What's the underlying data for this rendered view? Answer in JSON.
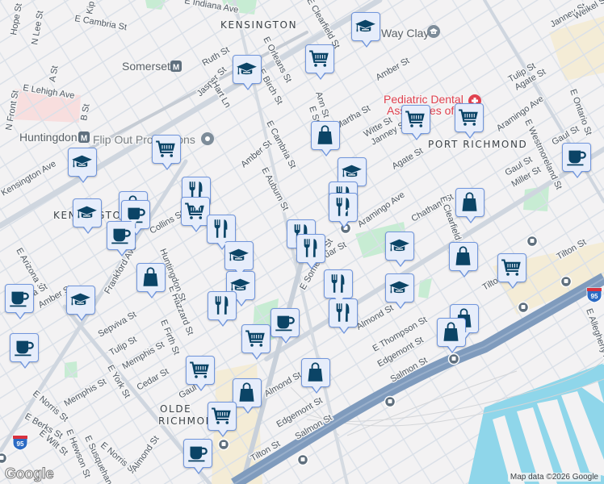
{
  "neighborhoods": [
    "KENSINGTON",
    "KENSINGTON",
    "PORT RICHMOND",
    "OLDE",
    "RICHMOND"
  ],
  "pois": {
    "somerset_station": "Somerset",
    "huntingdon_station": "Huntingdon",
    "flip_out": "Flip Out Productions",
    "way_clay": "Way Clay",
    "dental_line1": "Pediatric Dental",
    "dental_line2": "Associates of"
  },
  "streets": [
    "E Indiana Ave",
    "E Cambria St",
    "Hope St",
    "N Lee St",
    "Kip St",
    "Ruth St",
    "Jasper St",
    "Hart Ln",
    "E Orleans St",
    "E Birch St",
    "E Lehigh Ave",
    "A St",
    "N Front St",
    "B St",
    "Kensington Ave",
    "E Cambria St",
    "Amber St",
    "E Auburn St",
    "E Clearfield St",
    "Amber St",
    "Ann St",
    "E Sterner St",
    "Martha St",
    "Witte St",
    "Janney St",
    "Agate St",
    "Aramingo Ave",
    "Aramingo Ave",
    "Tulip St",
    "Agate St",
    "E Ontario St",
    "E Westmoreland St",
    "Gaul St",
    "Gaul St",
    "Miller St",
    "Janney St",
    "Weikel St",
    "Cedar St",
    "E Somerset St",
    "Chatham St",
    "E Clearfield St",
    "Tilton St",
    "Tilton St",
    "E Thompson St",
    "Edgemont St",
    "Salmon St",
    "Almond St",
    "E Allegheny Ave",
    "E Arizona St",
    "Amber St",
    "Sepviva St",
    "Tulip St",
    "Memphis St",
    "E Firth St",
    "E Hazzard St",
    "Huntingdon St",
    "E York St",
    "Cedar St",
    "Memphis St",
    "E Norris St",
    "E Berks St",
    "E Wilt St",
    "E Hewson St",
    "E Susquehanna",
    "E Norris St",
    "Almond St",
    "Almond St",
    "Edgemont St",
    "Salmon St",
    "Tilton St",
    "Gaul St",
    "Frankford Ave",
    "Martha St",
    "Collins St"
  ],
  "markers": [
    "school",
    "cart",
    "school",
    "cart",
    "school",
    "bag",
    "cart",
    "cart",
    "school",
    "food",
    "food",
    "food",
    "cart",
    "bag",
    "bag",
    "cup",
    "school",
    "cup",
    "food",
    "food",
    "food",
    "school",
    "school",
    "bag",
    "cart",
    "bag",
    "school",
    "school",
    "food",
    "food",
    "cup",
    "school",
    "food",
    "cup",
    "cup",
    "cart",
    "cup",
    "bag",
    "bag",
    "cart",
    "bag",
    "bag",
    "cart",
    "cup"
  ],
  "highway_shield": "95",
  "attribution": "Map data ©2026 Google",
  "logo": "Google",
  "colors": {
    "marker_bg": "#e6edfb",
    "marker_border": "#7196dc",
    "icon": "#0b4466",
    "highway": "#7f9bbd",
    "water": "#8fd6ea",
    "park": "#bfe9cf"
  }
}
